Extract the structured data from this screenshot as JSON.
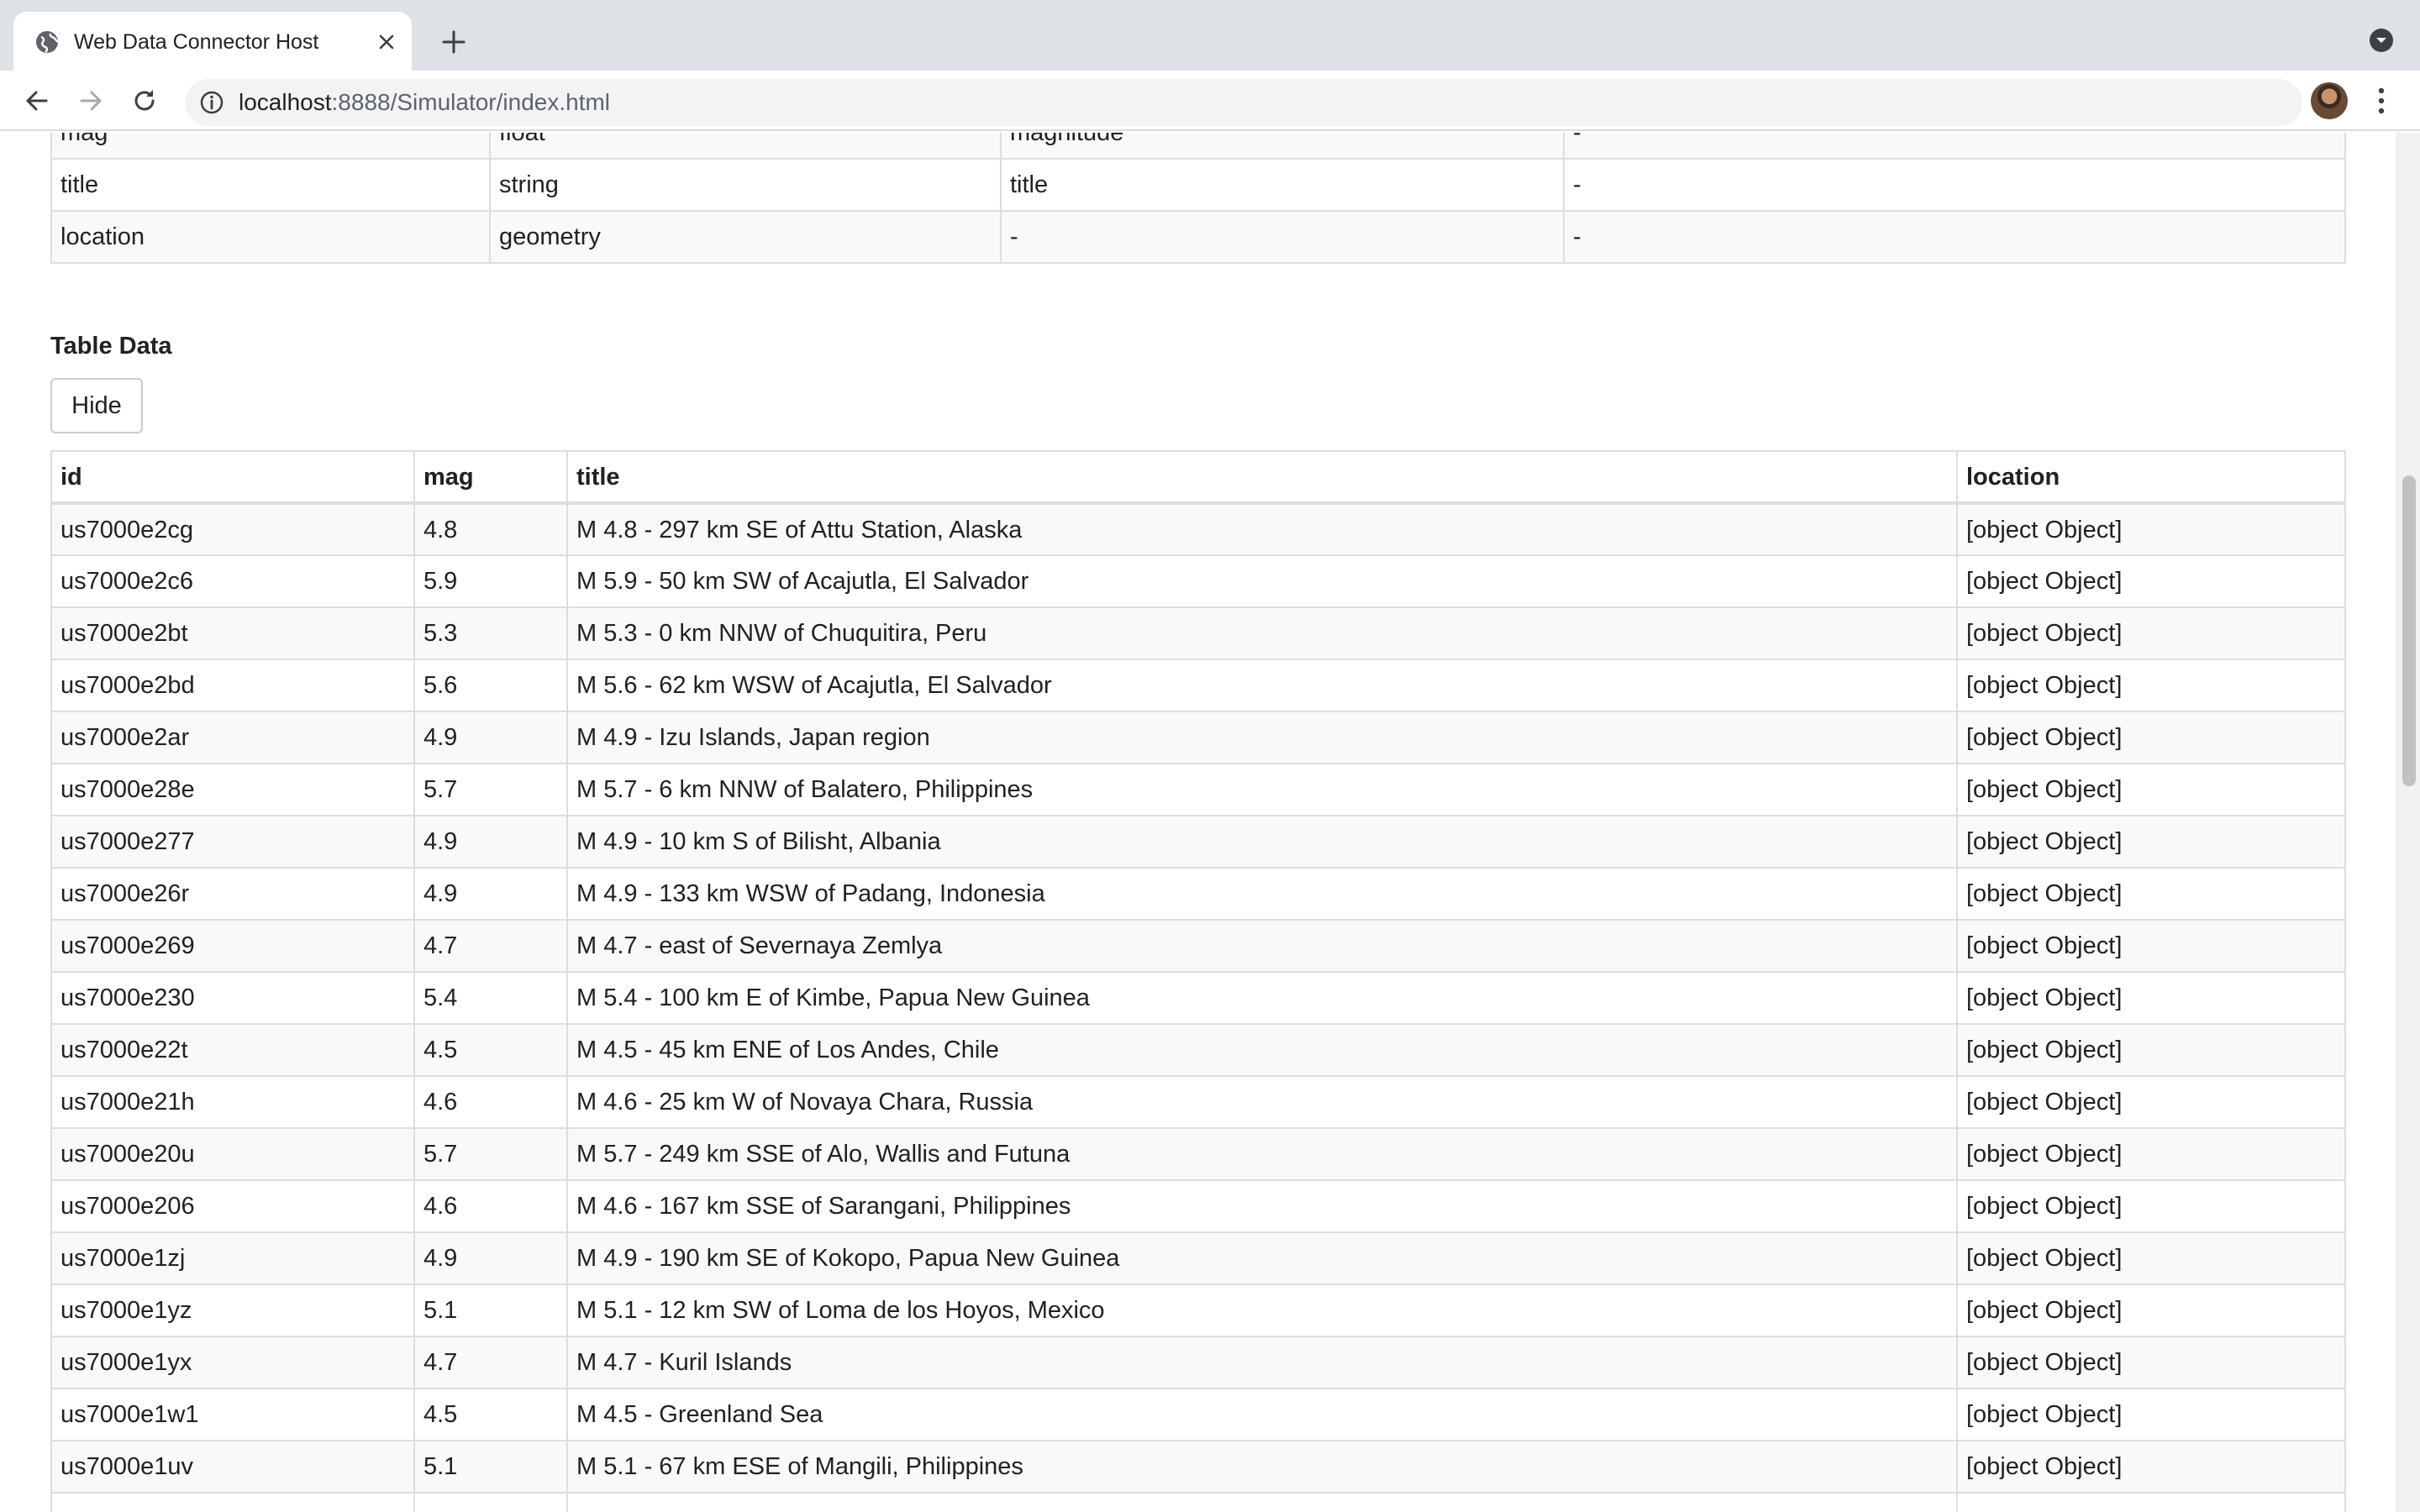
{
  "browser": {
    "tab_title": "Web Data Connector Host",
    "url_host": "localhost",
    "url_rest": ":8888/Simulator/index.html"
  },
  "schema_rows": [
    [
      "",
      "",
      "",
      ""
    ],
    [
      "mag",
      "float",
      "magnitude",
      "-"
    ],
    [
      "title",
      "string",
      "title",
      "-"
    ],
    [
      "location",
      "geometry",
      "-",
      "-"
    ]
  ],
  "table_data": {
    "heading": "Table Data",
    "hide_label": "Hide",
    "columns": [
      "id",
      "mag",
      "title",
      "location"
    ],
    "rows": [
      [
        "us7000e2cg",
        "4.8",
        "M 4.8 - 297 km SE of Attu Station, Alaska",
        "[object Object]"
      ],
      [
        "us7000e2c6",
        "5.9",
        "M 5.9 - 50 km SW of Acajutla, El Salvador",
        "[object Object]"
      ],
      [
        "us7000e2bt",
        "5.3",
        "M 5.3 - 0 km NNW of Chuquitira, Peru",
        "[object Object]"
      ],
      [
        "us7000e2bd",
        "5.6",
        "M 5.6 - 62 km WSW of Acajutla, El Salvador",
        "[object Object]"
      ],
      [
        "us7000e2ar",
        "4.9",
        "M 4.9 - Izu Islands, Japan region",
        "[object Object]"
      ],
      [
        "us7000e28e",
        "5.7",
        "M 5.7 - 6 km NNW of Balatero, Philippines",
        "[object Object]"
      ],
      [
        "us7000e277",
        "4.9",
        "M 4.9 - 10 km S of Bilisht, Albania",
        "[object Object]"
      ],
      [
        "us7000e26r",
        "4.9",
        "M 4.9 - 133 km WSW of Padang, Indonesia",
        "[object Object]"
      ],
      [
        "us7000e269",
        "4.7",
        "M 4.7 - east of Severnaya Zemlya",
        "[object Object]"
      ],
      [
        "us7000e230",
        "5.4",
        "M 5.4 - 100 km E of Kimbe, Papua New Guinea",
        "[object Object]"
      ],
      [
        "us7000e22t",
        "4.5",
        "M 4.5 - 45 km ENE of Los Andes, Chile",
        "[object Object]"
      ],
      [
        "us7000e21h",
        "4.6",
        "M 4.6 - 25 km W of Novaya Chara, Russia",
        "[object Object]"
      ],
      [
        "us7000e20u",
        "5.7",
        "M 5.7 - 249 km SSE of Alo, Wallis and Futuna",
        "[object Object]"
      ],
      [
        "us7000e206",
        "4.6",
        "M 4.6 - 167 km SSE of Sarangani, Philippines",
        "[object Object]"
      ],
      [
        "us7000e1zj",
        "4.9",
        "M 4.9 - 190 km SE of Kokopo, Papua New Guinea",
        "[object Object]"
      ],
      [
        "us7000e1yz",
        "5.1",
        "M 5.1 - 12 km SW of Loma de los Hoyos, Mexico",
        "[object Object]"
      ],
      [
        "us7000e1yx",
        "4.7",
        "M 4.7 - Kuril Islands",
        "[object Object]"
      ],
      [
        "us7000e1w1",
        "4.5",
        "M 4.5 - Greenland Sea",
        "[object Object]"
      ],
      [
        "us7000e1uv",
        "5.1",
        "M 5.1 - 67 km ESE of Mangili, Philippines",
        "[object Object]"
      ],
      [
        "",
        "",
        "",
        ""
      ]
    ]
  },
  "colors": {
    "tabstrip": "#dee1e6",
    "omnibox": "#f1f3f4",
    "row_alt": "#f9f9f9",
    "border": "#dddddd"
  }
}
